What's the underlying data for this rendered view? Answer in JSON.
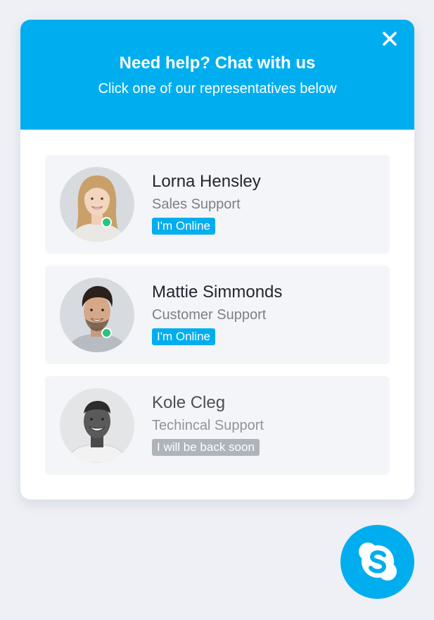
{
  "header": {
    "title": "Need help? Chat with us",
    "subtitle": "Click one of our representatives below",
    "close_icon": "close-icon",
    "background_color": "#00aeef"
  },
  "agents": [
    {
      "name": "Lorna Hensley",
      "role": "Sales Support",
      "status": "I'm Online",
      "online": true
    },
    {
      "name": "Mattie Simmonds",
      "role": "Customer Support",
      "status": "I'm Online",
      "online": true
    },
    {
      "name": "Kole Cleg",
      "role": "Techincal Support",
      "status": "I will be back soon",
      "online": false
    }
  ],
  "launcher": {
    "icon": "skype-icon"
  },
  "colors": {
    "accent": "#00aeef",
    "online_dot": "#27c47d",
    "away_badge": "#aeb4bc",
    "card_background": "#f4f5f8",
    "page_background": "#eef0f5"
  }
}
